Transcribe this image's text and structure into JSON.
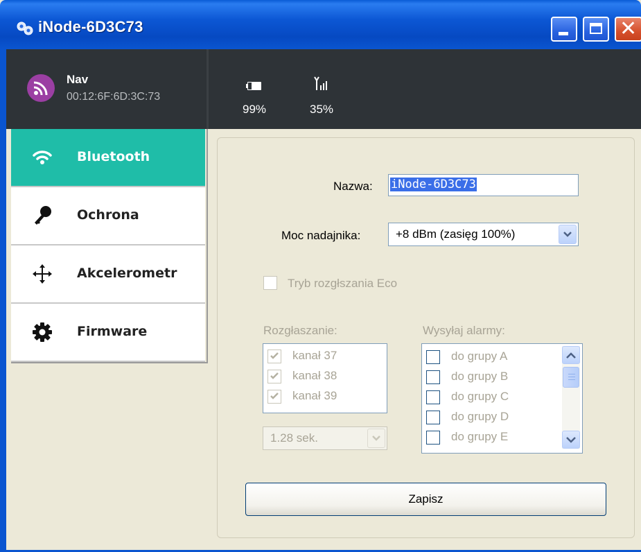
{
  "window": {
    "title": "iNode-6D3C73",
    "icon": "gears-icon",
    "controls": [
      "minimize-icon",
      "maximize-icon",
      "close-icon"
    ]
  },
  "header": {
    "device_name": "Nav",
    "mac": "00:12:6F:6D:3C:73",
    "avatar_icon": "rss-icon",
    "avatar_color": "#9b3fa3",
    "battery": {
      "icon": "battery-icon",
      "value": "99%"
    },
    "signal": {
      "icon": "signal-icon",
      "value": "35%"
    }
  },
  "sidebar": {
    "items": [
      {
        "label": "Bluetooth",
        "icon": "wifi-icon",
        "active": true
      },
      {
        "label": "Ochrona",
        "icon": "key-icon",
        "active": false
      },
      {
        "label": "Akcelerometr",
        "icon": "move-arrows-icon",
        "active": false
      },
      {
        "label": "Firmware",
        "icon": "gear-icon",
        "active": false
      }
    ],
    "active_color": "#1fbda8"
  },
  "form": {
    "name_label": "Nazwa:",
    "name_value": "iNode-6D3C73",
    "power_label": "Moc nadajnika:",
    "power_value": "+8 dBm  (zasięg 100%)",
    "eco_label": "Tryb rozgłszania Eco",
    "eco_checked": false,
    "advertising_label": "Rozgłaszanie:",
    "channels": [
      {
        "label": "kanał 37",
        "checked": true
      },
      {
        "label": "kanał 38",
        "checked": true
      },
      {
        "label": "kanał 39",
        "checked": true
      }
    ],
    "interval_value": "1.28 sek.",
    "alarms_label": "Wysyłaj alarmy:",
    "alarm_groups": [
      {
        "label": "do grupy A",
        "checked": false
      },
      {
        "label": "do grupy B",
        "checked": false
      },
      {
        "label": "do grupy C",
        "checked": false
      },
      {
        "label": "do grupy D",
        "checked": false
      },
      {
        "label": "do grupy E",
        "checked": false
      }
    ],
    "save_label": "Zapisz"
  }
}
